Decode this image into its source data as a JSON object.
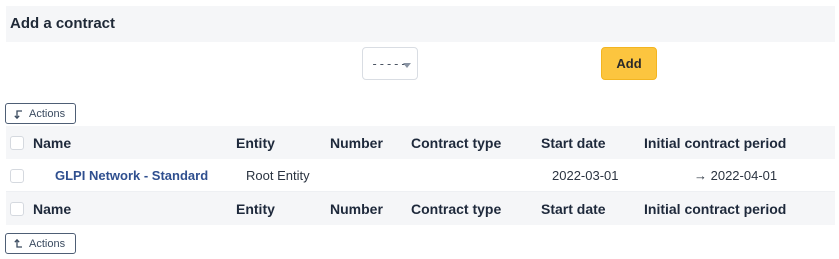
{
  "add_contract": {
    "title": "Add a contract",
    "select_value": "-----",
    "add_label": "Add"
  },
  "actions_label": "Actions",
  "table": {
    "columns": [
      "Name",
      "Entity",
      "Number",
      "Contract type",
      "Start date",
      "Initial contract period"
    ],
    "rows": [
      {
        "name": "GLPI Network - Standard",
        "entity": "Root Entity",
        "number": "",
        "contract_type": "",
        "start_date": "2022-03-01",
        "initial_contract_period": "→ 2022-04-01"
      }
    ]
  }
}
